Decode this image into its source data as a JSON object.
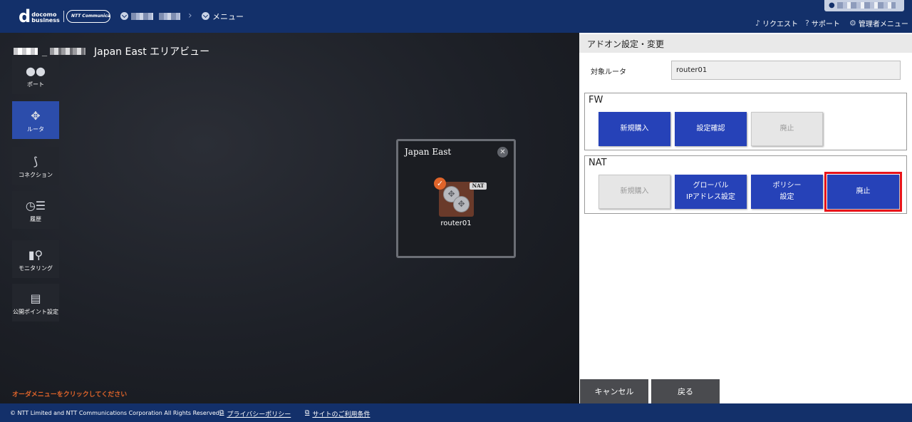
{
  "header": {
    "logo_d": "d",
    "logo_line1": "docomo",
    "logo_line2": "business",
    "ntt_logo_text": "NTT Communications",
    "menu_label": "メニュー",
    "links": {
      "request": "リクエスト",
      "support": "サポート",
      "admin_menu": "管理者メニュー"
    }
  },
  "area": {
    "separator": "_",
    "title": "Japan East エリアビュー"
  },
  "sidebar": {
    "items": [
      {
        "label": "ポート",
        "icon": "port-icon"
      },
      {
        "label": "ルータ",
        "icon": "router-icon",
        "active": true
      },
      {
        "label": "コネクション",
        "icon": "connection-icon"
      },
      {
        "label": "履歴",
        "icon": "history-icon"
      },
      {
        "label": "モニタリング",
        "icon": "monitoring-icon"
      },
      {
        "label": "公開ポイント設定",
        "icon": "public-point-icon"
      }
    ]
  },
  "hint": "オーダメニューをクリックしてください",
  "region_card": {
    "name": "Japan East",
    "close": "✕",
    "router_name": "router01",
    "badge": "NAT"
  },
  "panel": {
    "title": "アドオン設定・変更",
    "target_label": "対象ルータ",
    "target_value": "router01",
    "fw": {
      "title": "FW",
      "buttons": [
        "新規購入",
        "設定確認",
        "廃止"
      ]
    },
    "nat": {
      "title": "NAT",
      "buttons": [
        "新規購入",
        "グローバル\nIPアドレス設定",
        "ポリシー\n設定",
        "廃止"
      ]
    },
    "cancel": "キャンセル",
    "back": "戻る"
  },
  "footer": {
    "copyright": "© NTT Limited and NTT Communications Corporation All Rights Reserved.",
    "privacy": "プライバシーポリシー",
    "terms": "サイトのご利用条件"
  },
  "colors": {
    "header_bg": "#13306a",
    "primary_button": "#2642b8",
    "highlight": "#e8141a",
    "accent_orange": "#e0642a"
  }
}
